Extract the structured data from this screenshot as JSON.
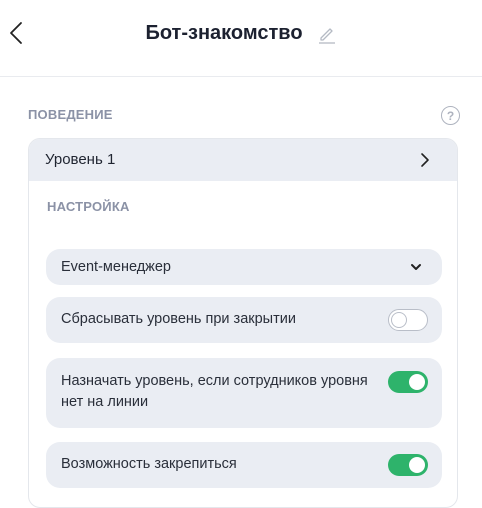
{
  "header": {
    "title": "Бот-знакомство"
  },
  "behavior": {
    "section_label": "ПОВЕДЕНИЕ",
    "help_glyph": "?",
    "level_label": "Уровень 1",
    "settings_label": "НАСТРОЙКА",
    "dropdown": {
      "selected": "Event-менеджер"
    },
    "options": [
      {
        "label": "Сбрасывать уровень при закрытии",
        "enabled": false
      },
      {
        "label": "Назначать уровень, если сотрудников уровня нет на линии",
        "enabled": true
      },
      {
        "label": "Возможность закрепиться",
        "enabled": true
      }
    ]
  },
  "colors": {
    "toggle_on": "#2eb36b",
    "row_background": "#eaedf3",
    "section_label": "#8b92a6"
  },
  "icons": {
    "back": "chevron-left-icon",
    "edit": "pencil-icon",
    "help": "question-circle-icon",
    "level": "chevron-right-icon",
    "dropdown": "chevron-down-icon"
  }
}
